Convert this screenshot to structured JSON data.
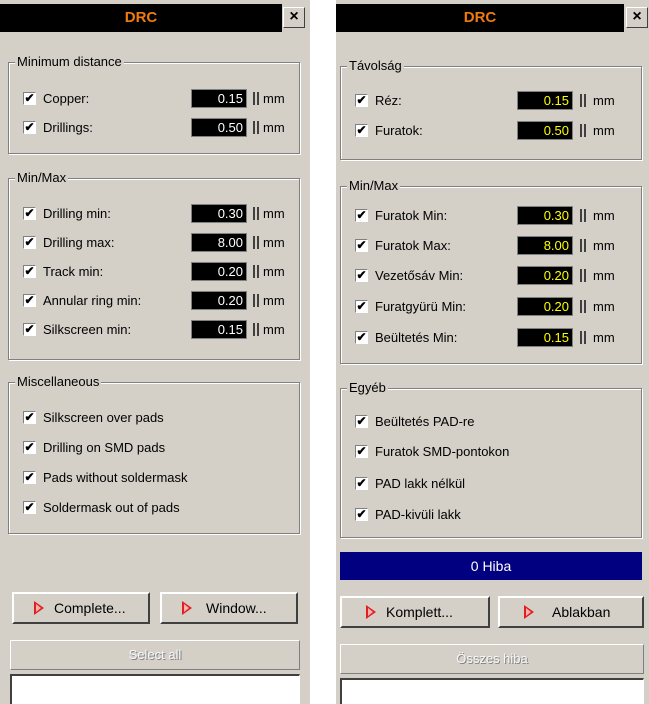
{
  "left": {
    "title": "DRC",
    "close": "×",
    "groups": [
      {
        "legend": "Minimum distance",
        "rows": [
          {
            "label": "Copper:",
            "value": "0.15",
            "unit": "mm",
            "checked": true
          },
          {
            "label": "Drillings:",
            "value": "0.50",
            "unit": "mm",
            "checked": true
          }
        ]
      },
      {
        "legend": "Min/Max",
        "rows": [
          {
            "label": "Drilling min:",
            "value": "0.30",
            "unit": "mm",
            "checked": true
          },
          {
            "label": "Drilling max:",
            "value": "8.00",
            "unit": "mm",
            "checked": true
          },
          {
            "label": "Track min:",
            "value": "0.20",
            "unit": "mm",
            "checked": true
          },
          {
            "label": "Annular ring min:",
            "value": "0.20",
            "unit": "mm",
            "checked": true
          },
          {
            "label": "Silkscreen min:",
            "value": "0.15",
            "unit": "mm",
            "checked": true
          }
        ]
      },
      {
        "legend": "Miscellaneous",
        "rows": [
          {
            "label": "Silkscreen over pads",
            "checked": true
          },
          {
            "label": "Drilling on SMD pads",
            "checked": true
          },
          {
            "label": "Pads without soldermask",
            "checked": true
          },
          {
            "label": "Soldermask out of pads",
            "checked": true
          }
        ]
      }
    ],
    "buttons": {
      "complete": "Complete...",
      "window": "Window...",
      "select_all": "Select all"
    }
  },
  "right": {
    "title": "DRC",
    "close": "×",
    "groups": [
      {
        "legend": "Távolság",
        "rows": [
          {
            "label": "Réz:",
            "value": "0.15",
            "unit": "mm",
            "checked": true
          },
          {
            "label": "Furatok:",
            "value": "0.50",
            "unit": "mm",
            "checked": true
          }
        ]
      },
      {
        "legend": "Min/Max",
        "rows": [
          {
            "label": "Furatok Min:",
            "value": "0.30",
            "unit": "mm",
            "checked": true
          },
          {
            "label": "Furatok Max:",
            "value": "8.00",
            "unit": "mm",
            "checked": true
          },
          {
            "label": "Vezetősáv Min:",
            "value": "0.20",
            "unit": "mm",
            "checked": true
          },
          {
            "label": "Furatgyürü Min:",
            "value": "0.20",
            "unit": "mm",
            "checked": true
          },
          {
            "label": "Beültetés Min:",
            "value": "0.15",
            "unit": "mm",
            "checked": true
          }
        ]
      },
      {
        "legend": "Egyéb",
        "rows": [
          {
            "label": "Beültetés PAD-re",
            "checked": true
          },
          {
            "label": "Furatok SMD-pontokon",
            "checked": true
          },
          {
            "label": "PAD lakk nélkül",
            "checked": true
          },
          {
            "label": "PAD-kivüli lakk",
            "checked": true
          }
        ]
      }
    ],
    "status": "0 Hiba",
    "buttons": {
      "complete": "Komplett...",
      "window": "Ablakban",
      "select_all": "Összes hiba"
    }
  },
  "check_mark": "✔",
  "colors": {
    "title_text": "#f07a10",
    "left_value_text": "#ffffff",
    "right_value_text": "#ffff00",
    "status_bar": "#000080"
  }
}
